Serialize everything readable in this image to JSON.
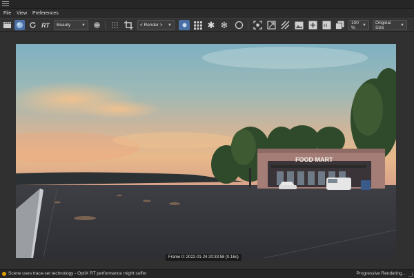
{
  "menubar": {
    "items": [
      "File",
      "View",
      "Preferences"
    ]
  },
  "toolbar": {
    "rt_label": "RT",
    "render_mode": "Beauty",
    "render_target": "< Render >",
    "zoom": "100 %",
    "size_mode": "Original Size",
    "icons": [
      "clapperboard-icon",
      "render-sphere-icon",
      "refresh-icon",
      "record-icon",
      "grid-dots-icon",
      "crop-icon",
      "pick-icon",
      "pixel-grid-icon",
      "snowflake-icon",
      "snowflake-alt-icon",
      "circle-icon",
      "region-icon",
      "fit-icon",
      "edit-icon",
      "image-icon",
      "add-image-icon",
      "history-icon",
      "copy-icon"
    ]
  },
  "render": {
    "sign_text": "FOOD MART",
    "frame_info": "Frame 0:  2022-01-24  20:33:58  (0.16s)"
  },
  "status": {
    "message": "Scene uses trace-set technology - OptiX RT performance might suffer",
    "progress_text": "Progressive Rendering..."
  },
  "colors": {
    "status_warning": "#e0a000",
    "active_tool": "#4a6fa5"
  }
}
